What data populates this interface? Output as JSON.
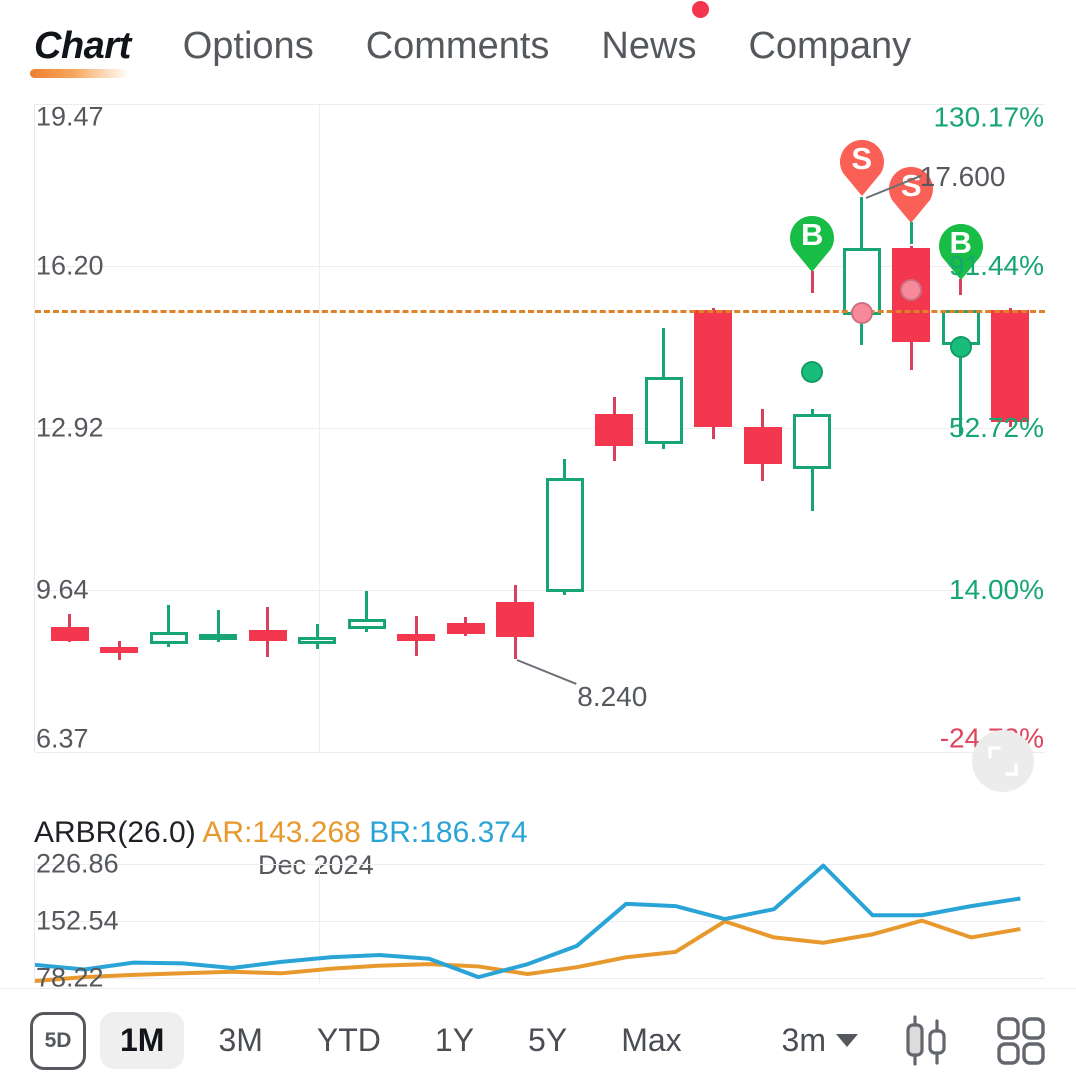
{
  "tabs": [
    {
      "label": "Chart",
      "active": true,
      "badge": false
    },
    {
      "label": "Options",
      "active": false,
      "badge": false
    },
    {
      "label": "Comments",
      "active": false,
      "badge": false
    },
    {
      "label": "News",
      "active": false,
      "badge": true
    },
    {
      "label": "Company",
      "active": false,
      "badge": false
    }
  ],
  "colors": {
    "up": "#17a673",
    "down": "#f2374f",
    "baseline": "#e08128",
    "positive_pct": "#17a673",
    "negative_pct": "#e0455f",
    "ar_line": "#e8992e",
    "br_line": "#2aa4d6",
    "buy_pin": "#18bd45",
    "sell_pin": "#fa6055",
    "active_tab_underline": "#ef7f2e",
    "news_badge": "#f5344f"
  },
  "chart_data": {
    "type": "candlestick",
    "title": "",
    "xlabel": "Dec 2024",
    "y_axis_left": {
      "ticks": [
        "19.47",
        "16.20",
        "12.92",
        "9.64",
        "6.37"
      ],
      "min": 6.37,
      "max": 19.47
    },
    "y_axis_right": {
      "ticks": [
        "130.17%",
        "91.44%",
        "52.72%",
        "14.00%",
        "-24.73%"
      ],
      "tick_colors": [
        "#17a673",
        "#17a673",
        "#17a673",
        "#17a673",
        "#e0455f"
      ],
      "min": -24.73,
      "max": 130.17
    },
    "baseline_dashed_value": 15.3,
    "annotations": [
      {
        "label": "17.600",
        "type": "high-callout"
      },
      {
        "label": "8.240",
        "type": "low-callout"
      }
    ],
    "trade_markers": [
      {
        "type": "S",
        "index": 18,
        "label": "S"
      },
      {
        "type": "S",
        "index": 19,
        "label": "S"
      },
      {
        "type": "B",
        "index": 14,
        "label": "B"
      },
      {
        "type": "B",
        "index": 20,
        "label": "B"
      }
    ],
    "candles": [
      {
        "o": 8.9,
        "h": 9.15,
        "l": 8.6,
        "c": 8.62
      },
      {
        "o": 8.5,
        "h": 8.62,
        "l": 8.22,
        "c": 8.4
      },
      {
        "o": 8.55,
        "h": 9.35,
        "l": 8.5,
        "c": 8.8
      },
      {
        "o": 8.64,
        "h": 9.25,
        "l": 8.6,
        "c": 8.76
      },
      {
        "o": 8.84,
        "h": 9.3,
        "l": 8.3,
        "c": 8.62
      },
      {
        "o": 8.56,
        "h": 8.95,
        "l": 8.45,
        "c": 8.7
      },
      {
        "o": 8.85,
        "h": 9.62,
        "l": 8.8,
        "c": 9.05
      },
      {
        "o": 8.76,
        "h": 9.12,
        "l": 8.32,
        "c": 8.62
      },
      {
        "o": 8.98,
        "h": 9.1,
        "l": 8.72,
        "c": 8.76
      },
      {
        "o": 9.4,
        "h": 9.75,
        "l": 8.24,
        "c": 8.7
      },
      {
        "o": 9.6,
        "h": 12.3,
        "l": 9.55,
        "c": 11.9
      },
      {
        "o": 13.2,
        "h": 13.55,
        "l": 12.25,
        "c": 12.55
      },
      {
        "o": 12.6,
        "h": 14.95,
        "l": 12.5,
        "c": 13.95
      },
      {
        "o": 15.3,
        "h": 15.35,
        "l": 12.7,
        "c": 12.95
      },
      {
        "o": 12.95,
        "h": 13.3,
        "l": 11.85,
        "c": 12.2
      },
      {
        "o": 12.1,
        "h": 13.3,
        "l": 11.25,
        "c": 13.2
      },
      {
        "o": 15.2,
        "h": 17.6,
        "l": 14.6,
        "c": 16.55
      },
      {
        "o": 16.55,
        "h": 16.6,
        "l": 14.1,
        "c": 14.65
      },
      {
        "o": 14.6,
        "h": 15.3,
        "l": 12.8,
        "c": 15.3
      },
      {
        "o": 15.3,
        "h": 15.35,
        "l": 12.95,
        "c": 13.05
      }
    ]
  },
  "indicator": {
    "name": "ARBR(26.0)",
    "ar_label": "AR:143.268",
    "br_label": "BR:186.374",
    "y_ticks": [
      "226.86",
      "152.54",
      "78.22"
    ],
    "series": [
      {
        "name": "AR",
        "color": "#e8992e",
        "values": [
          74,
          79,
          82,
          84,
          86,
          84,
          90,
          94,
          96,
          93,
          83,
          92,
          105,
          112,
          152,
          131,
          124,
          135,
          153,
          131,
          142
        ]
      },
      {
        "name": "BR",
        "color": "#2aa4d6",
        "values": [
          95,
          89,
          98,
          97,
          91,
          99,
          105,
          108,
          103,
          79,
          96,
          120,
          175,
          172,
          155,
          168,
          225,
          160,
          160,
          172,
          182
        ]
      }
    ],
    "ylim": [
      70,
      235
    ]
  },
  "toolbar": {
    "ranges": [
      {
        "label": "5D",
        "active": false,
        "boxed": true
      },
      {
        "label": "1M",
        "active": true,
        "boxed": false
      },
      {
        "label": "3M",
        "active": false,
        "boxed": false
      },
      {
        "label": "YTD",
        "active": false,
        "boxed": false
      },
      {
        "label": "1Y",
        "active": false,
        "boxed": false
      },
      {
        "label": "5Y",
        "active": false,
        "boxed": false
      },
      {
        "label": "Max",
        "active": false,
        "boxed": false
      }
    ],
    "period_select": "3m",
    "chart_type_icon": "candlestick-icon",
    "more_icon": "grid-icon"
  },
  "fullscreen_button": "expand-icon"
}
